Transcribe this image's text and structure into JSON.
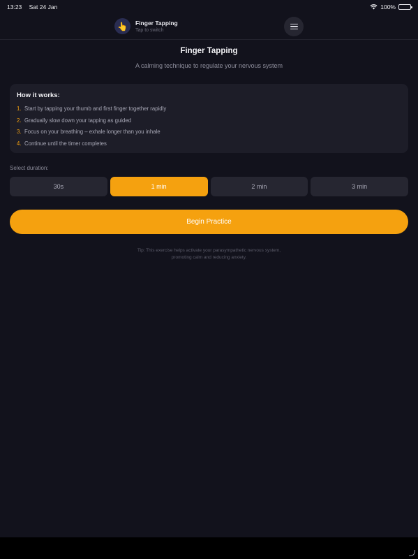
{
  "status_bar": {
    "time": "13:23",
    "date": "Sat 24 Jan",
    "battery": "100%"
  },
  "header": {
    "exercise_icon": "pointing-hand-emoji",
    "exercise_emoji": "👆",
    "exercise_title": "Finger Tapping",
    "exercise_subtitle": "Tap to switch",
    "menu_icon": "hamburger-icon"
  },
  "page": {
    "title": "Finger Tapping",
    "subtitle": "A calming technique to regulate your nervous system"
  },
  "how_it_works": {
    "title": "How it works:",
    "steps": [
      {
        "num": "1.",
        "text": "Start by tapping your thumb and first finger together rapidly"
      },
      {
        "num": "2.",
        "text": "Gradually slow down your tapping as guided"
      },
      {
        "num": "3.",
        "text": "Focus on your breathing – exhale longer than you inhale"
      },
      {
        "num": "4.",
        "text": "Continue until the timer completes"
      }
    ]
  },
  "duration": {
    "label": "Select duration:",
    "options": [
      "30s",
      "1 min",
      "2 min",
      "3 min"
    ],
    "selected": "1 min"
  },
  "begin_button": "Begin Practice",
  "tip": {
    "line1": "Tip: This exercise helps activate your parasympathetic nervous system,",
    "line2": "promoting calm and reducing anxiety."
  },
  "colors": {
    "background": "#12121c",
    "accent": "#f5a10f",
    "card": "#1d1d28"
  }
}
